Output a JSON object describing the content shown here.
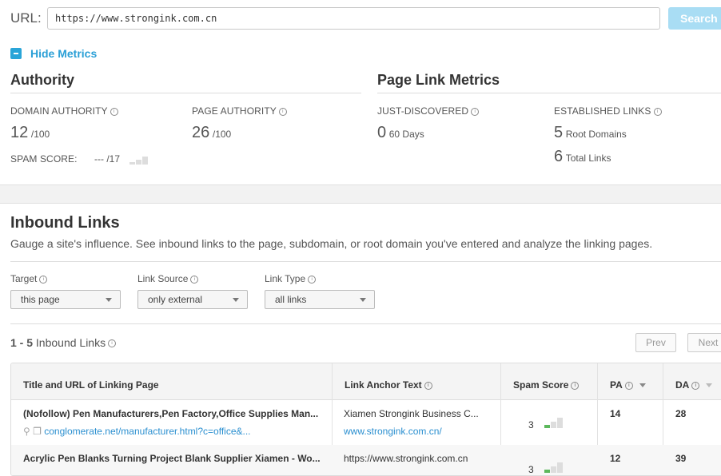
{
  "url_bar": {
    "label": "URL:",
    "value": "https://www.strongink.com.cn",
    "search_label": "Search"
  },
  "metrics_toggle": {
    "label": "Hide Metrics"
  },
  "authority": {
    "title": "Authority",
    "domain_authority": {
      "label": "DOMAIN AUTHORITY",
      "value": "12",
      "suffix": "/100"
    },
    "page_authority": {
      "label": "PAGE AUTHORITY",
      "value": "26",
      "suffix": "/100"
    },
    "spam_score": {
      "label": "SPAM SCORE:",
      "value": "---",
      "suffix": "/17"
    }
  },
  "page_link_metrics": {
    "title": "Page Link Metrics",
    "just_discovered": {
      "label": "JUST-DISCOVERED",
      "value": "0",
      "suffix": "60 Days"
    },
    "established_links": {
      "label": "ESTABLISHED LINKS",
      "root_value": "5",
      "root_label": "Root Domains",
      "total_value": "6",
      "total_label": "Total Links"
    }
  },
  "inbound": {
    "title": "Inbound Links",
    "description": "Gauge a site's influence. See inbound links to the page, subdomain, or root domain you've entered and analyze the linking pages.",
    "filters": [
      {
        "label": "Target",
        "value": "this page"
      },
      {
        "label": "Link Source",
        "value": "only external"
      },
      {
        "label": "Link Type",
        "value": "all links"
      }
    ],
    "count_range": "1 - 5",
    "count_label": "Inbound Links",
    "prev_label": "Prev",
    "next_label": "Next"
  },
  "table": {
    "headers": [
      "Title and URL of Linking Page",
      "Link Anchor Text",
      "Spam Score",
      "PA",
      "DA"
    ],
    "rows": [
      {
        "title": "(Nofollow) Pen Manufacturers,Pen Factory,Office Supplies Man...",
        "url": "conglomerate.net/manufacturer.html?c=office&...",
        "anchor": "Xiamen Strongink Business C...",
        "anchor_url": "www.strongink.com.cn/",
        "spam": "3",
        "pa": "14",
        "da": "28"
      },
      {
        "title": "Acrylic Pen Blanks Turning Project Blank Supplier Xiamen - Wo...",
        "url": "",
        "anchor": "https://www.strongink.com.cn",
        "anchor_url": "",
        "spam": "3",
        "pa": "12",
        "da": "39"
      }
    ]
  },
  "colors": {
    "accent": "#2a9fd6",
    "spam_low": "#5cb85c",
    "bar_gray": "#dddddd"
  }
}
